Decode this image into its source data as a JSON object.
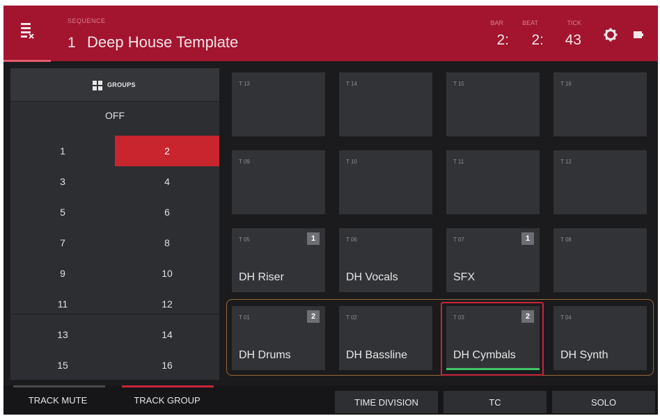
{
  "header": {
    "sequence_label": "SEQUENCE",
    "sequence_number": "1",
    "sequence_name": "Deep House Template",
    "bar_label": "BAR",
    "bar_value": "2:",
    "beat_label": "BEAT",
    "beat_value": "2:",
    "tick_label": "TICK",
    "tick_value": "43",
    "settings_icon": "gear-icon",
    "battery_icon": "battery-icon",
    "sequence_icon": "sequence-list-icon"
  },
  "groups_panel": {
    "title": "GROUPS",
    "off_label": "OFF",
    "items": [
      "1",
      "2",
      "3",
      "4",
      "5",
      "6",
      "7",
      "8",
      "9",
      "10",
      "11",
      "12",
      "13",
      "14",
      "15",
      "16"
    ],
    "selected": "2"
  },
  "pads": [
    {
      "id": "T 13",
      "name": "",
      "badge": ""
    },
    {
      "id": "T 14",
      "name": "",
      "badge": ""
    },
    {
      "id": "T 15",
      "name": "",
      "badge": ""
    },
    {
      "id": "T 16",
      "name": "",
      "badge": ""
    },
    {
      "id": "T 09",
      "name": "",
      "badge": ""
    },
    {
      "id": "T 10",
      "name": "",
      "badge": ""
    },
    {
      "id": "T 11",
      "name": "",
      "badge": ""
    },
    {
      "id": "T 12",
      "name": "",
      "badge": ""
    },
    {
      "id": "T 05",
      "name": "DH Riser",
      "badge": "1"
    },
    {
      "id": "T 06",
      "name": "DH Vocals",
      "badge": ""
    },
    {
      "id": "T 07",
      "name": "SFX",
      "badge": "1"
    },
    {
      "id": "T 08",
      "name": "",
      "badge": ""
    },
    {
      "id": "T 01",
      "name": "DH Drums",
      "badge": "2"
    },
    {
      "id": "T 02",
      "name": "DH Bassline",
      "badge": ""
    },
    {
      "id": "T 03",
      "name": "DH Cymbals",
      "badge": "2"
    },
    {
      "id": "T 04",
      "name": "DH Synth",
      "badge": ""
    }
  ],
  "selected_pad": "T 03",
  "bottom_bar": {
    "track_mute": "TRACK MUTE",
    "track_group": "TRACK GROUP",
    "time_division": "TIME DIVISION",
    "tc": "TC",
    "solo": "SOLO"
  },
  "colors": {
    "header": "#a3142f",
    "active_group": "#c8252f",
    "selection_outline": "#c8253c",
    "row_outline": "#9a6a3b",
    "playing_indicator": "#42c46a"
  }
}
